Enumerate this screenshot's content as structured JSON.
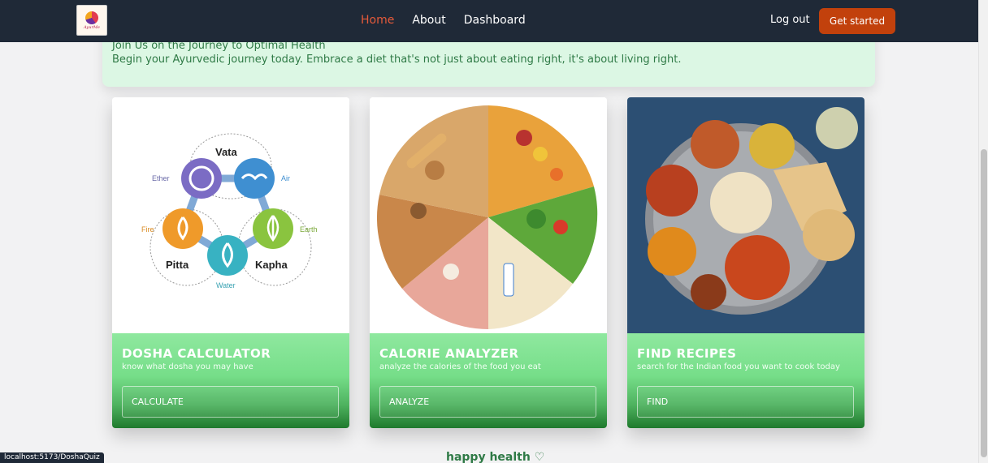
{
  "nav": {
    "logo_text": "AyurMe",
    "links": [
      "Home",
      "About",
      "Dashboard"
    ],
    "logout": "Log out",
    "cta": "Get started"
  },
  "hero": {
    "title": "Join Us on the Journey to Optimal Health",
    "subtitle": "Begin your Ayurvedic journey today. Embrace a diet that's not just about eating right, it's about living right."
  },
  "dosha_diagram": {
    "labels": [
      "Vata",
      "Pitta",
      "Kapha"
    ],
    "elements": [
      "Ether",
      "Air",
      "Fire",
      "Earth",
      "Water"
    ]
  },
  "cards": [
    {
      "title": "DOSHA CALCULATOR",
      "desc": "know what dosha you may have",
      "button": "CALCULATE"
    },
    {
      "title": "CALORIE ANALYZER",
      "desc": "analyze the calories of the food you eat",
      "button": "ANALYZE"
    },
    {
      "title": "FIND RECIPES",
      "desc": "search for the Indian food you want to cook today",
      "button": "FIND"
    }
  ],
  "footer": {
    "tagline": "happy health ♡"
  },
  "status_bar": {
    "url": "localhost:5173/DoshaQuiz"
  },
  "colors": {
    "nav_bg": "#1f2937",
    "active_link": "#e45a3a",
    "cta_bg": "#c2410c",
    "hero_bg": "#dcf7e4",
    "card_green": "#76de89"
  }
}
